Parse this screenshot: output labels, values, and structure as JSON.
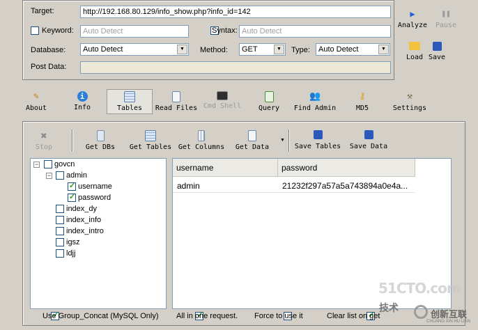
{
  "request": {
    "target_label": "Target:",
    "target_value": "http://192.168.80.129/info_show.php?info_id=142",
    "keyword_label": "Keyword:",
    "keyword_placeholder": "Auto Detect",
    "syntax_label": "Syntax:",
    "syntax_placeholder": "Auto Detect",
    "database_label": "Database:",
    "database_value": "Auto Detect",
    "method_label": "Method:",
    "method_value": "GET",
    "type_label": "Type:",
    "type_value": "Auto Detect",
    "postdata_label": "Post Data:"
  },
  "actions": {
    "analyze": "Analyze",
    "pause": "Pause",
    "load": "Load",
    "save": "Save"
  },
  "main_toolbar": [
    "About",
    "Info",
    "Tables",
    "Read Files",
    "Cmd Shell",
    "Query",
    "Find Admin",
    "MD5",
    "Settings"
  ],
  "tables_toolbar": [
    "Stop",
    "Get DBs",
    "Get Tables",
    "Get Columns",
    "Get Data",
    "Save Tables",
    "Save Data"
  ],
  "tree": {
    "db": "govcn",
    "table_open": "admin",
    "columns": [
      "username",
      "password"
    ],
    "tables": [
      "index_dy",
      "index_info",
      "index_intro",
      "igsz",
      "ldjj"
    ]
  },
  "grid": {
    "headers": [
      "username",
      "password"
    ],
    "rows": [
      [
        "admin",
        "21232f297a57a5a743894a0e4a..."
      ]
    ]
  },
  "options": {
    "group_concat": "Use Group_Concat (MySQL Only)",
    "all_in_one": "All in one request.",
    "force": "Force to use it",
    "clear_list": "Clear list on get"
  },
  "watermark": {
    "site": "51CTO.com",
    "sub": "技术",
    "brand": "创新互联",
    "brand_sub": "CHUANG XIN HU LIAN"
  },
  "colors": {
    "bg": "#d4d0c8",
    "field_border": "#7f9db9",
    "check": "#21a121"
  }
}
